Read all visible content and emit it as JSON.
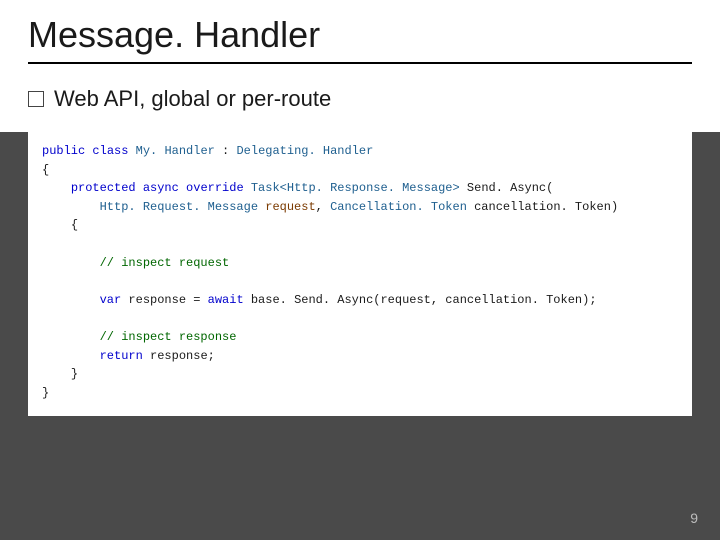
{
  "slide": {
    "title": "Message. Handler",
    "bullet_text": "Web API, global or per-route",
    "page_number": "9"
  },
  "code": {
    "kw_public": "public",
    "kw_class": "class",
    "cls_name": "My. Handler",
    "colon": " : ",
    "base_type": "Delegating. Handler",
    "brace_open": "{",
    "kw_protected": "protected",
    "kw_async": "async",
    "kw_override": "override",
    "ret_type_open": "Task<",
    "ret_type_inner": "Http. Response. Message",
    "ret_type_close": ">",
    "method_name": "Send. Async",
    "paren_open": "(",
    "param1_type": "Http. Request. Message",
    "param1_name": "request",
    "comma": ", ",
    "param2_type": "Cancellation. Token",
    "param2_name": "cancellation. Token",
    "paren_close": ")",
    "body_brace_open": "{",
    "comment1": "// inspect request",
    "kw_var": "var",
    "resp_name": "response",
    "eq": " = ",
    "kw_await": "await",
    "base_call": " base. Send. Async(request, cancellation. Token);",
    "comment2": "// inspect response",
    "kw_return": "return",
    "ret_val": " response;",
    "body_brace_close": "}",
    "brace_close": "}"
  }
}
